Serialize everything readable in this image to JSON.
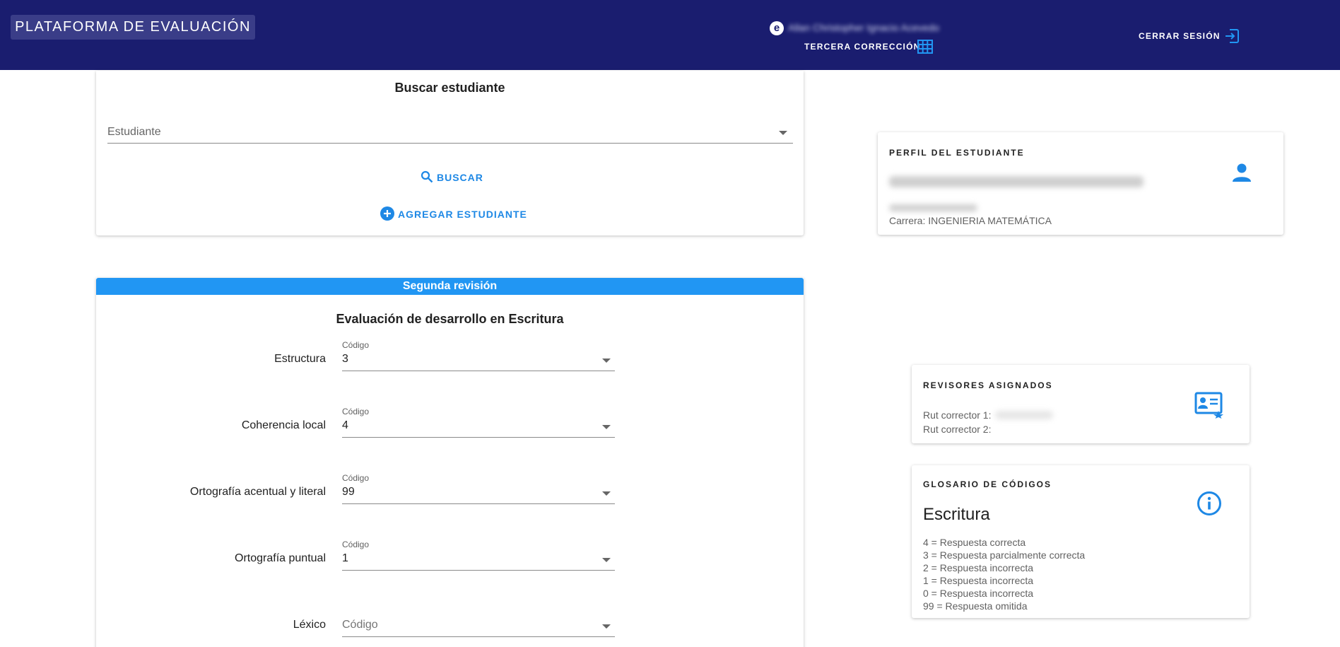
{
  "header": {
    "brand": "PLATAFORMA DE EVALUACIÓN",
    "user_initial": "e",
    "user_name": "Allan Christopher Ignacio Acevedo",
    "mode_label": "TERCERA CORRECCIÓN",
    "mode_icon": "grid-table-icon",
    "logout_label": "CERRAR SESIÓN",
    "logout_icon": "logout-icon",
    "bg_color": "#1a1d6f"
  },
  "search": {
    "title": "Buscar estudiante",
    "student_placeholder": "Estudiante",
    "search_button": "BUSCAR",
    "add_button": "AGREGAR ESTUDIANTE",
    "accent": "#1e88e5"
  },
  "profile": {
    "caption": "PERFIL DEL ESTUDIANTE",
    "career": "Carrera: INGENIERIA MATEMÁTICA",
    "icon": "person-icon"
  },
  "evaluation": {
    "banner": "Segunda revisión",
    "title": "Evaluación de desarrollo en Escritura",
    "field_caption": "Código",
    "placeholder": "Código",
    "rows": [
      {
        "label": "Estructura",
        "value": "3"
      },
      {
        "label": "Coherencia local",
        "value": "4"
      },
      {
        "label": "Ortografía acentual y literal",
        "value": "99"
      },
      {
        "label": "Ortografía puntual",
        "value": "1"
      },
      {
        "label": "Léxico",
        "value": ""
      }
    ],
    "banner_color": "#2196f3"
  },
  "reviewers": {
    "caption": "REVISORES ASIGNADOS",
    "line1": "Rut corrector 1:",
    "line2": "Rut corrector 2:",
    "icon": "reviewer-card-icon"
  },
  "glossary": {
    "caption": "GLOSARIO DE CÓDIGOS",
    "heading": "Escritura",
    "icon": "info-icon",
    "items": [
      "4 = Respuesta correcta",
      "3 = Respuesta parcialmente correcta",
      "2 = Respuesta incorrecta",
      "1 = Respuesta incorrecta",
      "0 = Respuesta incorrecta",
      "99 = Respuesta omitida"
    ]
  }
}
